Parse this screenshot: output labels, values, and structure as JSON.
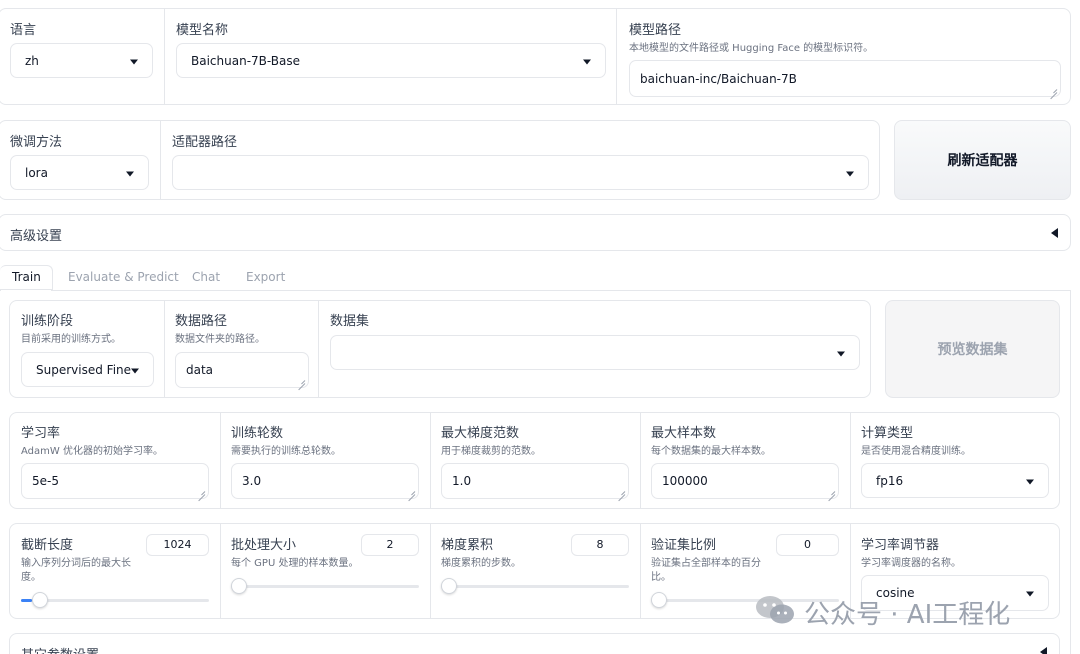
{
  "top": {
    "lang": {
      "label": "语言",
      "value": "zh"
    },
    "model_name": {
      "label": "模型名称",
      "value": "Baichuan-7B-Base"
    },
    "model_path": {
      "label": "模型路径",
      "sub": "本地模型的文件路径或 Hugging Face 的模型标识符。",
      "value": "baichuan-inc/Baichuan-7B"
    }
  },
  "adapter": {
    "finetune": {
      "label": "微调方法",
      "value": "lora"
    },
    "path": {
      "label": "适配器路径",
      "value": ""
    },
    "refresh_button": "刷新适配器"
  },
  "advanced": {
    "label": "高级设置"
  },
  "tabs": [
    "Train",
    "Evaluate & Predict",
    "Chat",
    "Export"
  ],
  "train": {
    "stage": {
      "label": "训练阶段",
      "sub": "目前采用的训练方式。",
      "value": "Supervised Fine"
    },
    "data_path": {
      "label": "数据路径",
      "sub": "数据文件夹的路径。",
      "value": "data"
    },
    "dataset": {
      "label": "数据集",
      "value": ""
    },
    "preview_button": "预览数据集",
    "lr": {
      "label": "学习率",
      "sub": "AdamW 优化器的初始学习率。",
      "value": "5e-5"
    },
    "epochs": {
      "label": "训练轮数",
      "sub": "需要执行的训练总轮数。",
      "value": "3.0"
    },
    "max_grad_norm": {
      "label": "最大梯度范数",
      "sub": "用于梯度裁剪的范数。",
      "value": "1.0"
    },
    "max_samples": {
      "label": "最大样本数",
      "sub": "每个数据集的最大样本数。",
      "value": "100000"
    },
    "compute_type": {
      "label": "计算类型",
      "sub": "是否使用混合精度训练。",
      "value": "fp16"
    },
    "cutoff_len": {
      "label": "截断长度",
      "sub1": "输入序列分词后的最大长",
      "sub2": "度。",
      "value": "1024",
      "fraction": 0.06
    },
    "batch_size": {
      "label": "批处理大小",
      "sub": "每个 GPU 处理的样本数量。",
      "value": "2",
      "fraction": 0.0
    },
    "grad_accum": {
      "label": "梯度累积",
      "sub": "梯度累积的步数。",
      "value": "8",
      "fraction": 0.0
    },
    "val_size": {
      "label": "验证集比例",
      "sub1": "验证集占全部样本的百分",
      "sub2": "比。",
      "value": "0",
      "fraction": 0.0
    },
    "lr_scheduler": {
      "label": "学习率调节器",
      "sub": "学习率调度器的名称。",
      "value": "cosine"
    },
    "other": {
      "label": "其它参数设置"
    }
  },
  "watermark": "公众号 · AI工程化"
}
